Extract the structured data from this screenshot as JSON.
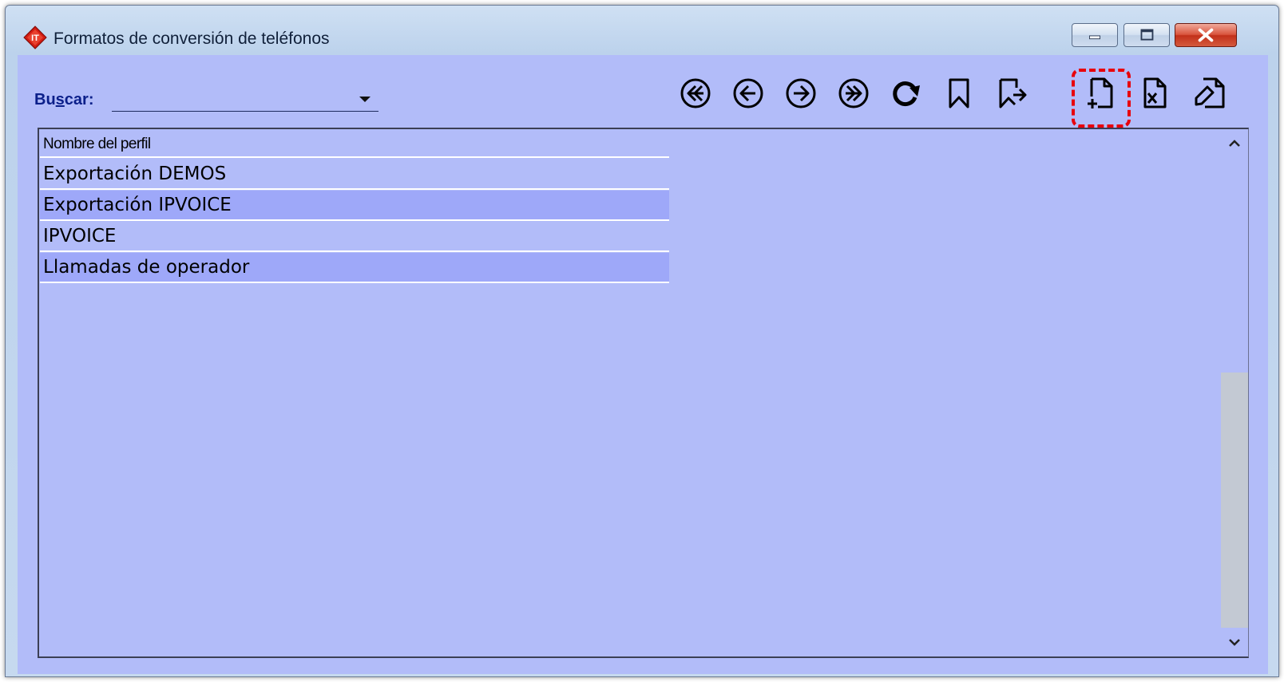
{
  "window": {
    "title": "Formatos de conversión de teléfonos",
    "icon": "app-logo-icon"
  },
  "search": {
    "label": "Buscar:",
    "value": "",
    "placeholder": ""
  },
  "toolbar": {
    "buttons": [
      {
        "name": "first-record",
        "icon": "double-arrow-left-circle-icon"
      },
      {
        "name": "previous-record",
        "icon": "arrow-left-circle-icon"
      },
      {
        "name": "next-record",
        "icon": "arrow-right-circle-icon"
      },
      {
        "name": "last-record",
        "icon": "double-arrow-right-circle-icon"
      },
      {
        "name": "refresh",
        "icon": "refresh-icon"
      },
      {
        "name": "bookmark",
        "icon": "bookmark-icon"
      },
      {
        "name": "go-to-bookmark",
        "icon": "bookmark-arrow-icon"
      },
      {
        "name": "new-record",
        "icon": "new-document-icon",
        "highlighted": true
      },
      {
        "name": "delete-record",
        "icon": "delete-document-icon"
      },
      {
        "name": "edit-record",
        "icon": "edit-document-icon"
      }
    ],
    "highlight_color": "#e8000b"
  },
  "grid": {
    "columns": [
      "Nombre del perfil"
    ],
    "rows": [
      "Exportación DEMOS",
      "Exportación IPVOICE",
      "IPVOICE",
      "Llamadas de operador"
    ],
    "background_color": "#b2bcf9",
    "alt_row_color": "#9ea8f9"
  }
}
